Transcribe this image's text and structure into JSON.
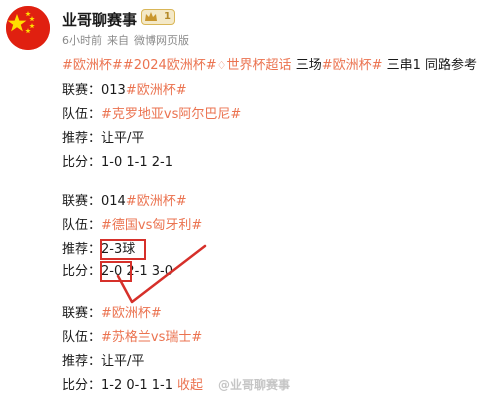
{
  "post": {
    "username": "业哥聊赛事",
    "level": "1",
    "time": "6小时前",
    "source_prefix": "来自",
    "source": "微博网页版"
  },
  "content": {
    "header": {
      "tag1": "#欧洲杯#",
      "tag2": "#2024欧洲杯#",
      "diamond": "♢",
      "topic": "世界杯超话",
      "text1": " 三场",
      "tag3": "#欧洲杯#",
      "text2": " 三串1 同路参考"
    },
    "matches": [
      {
        "league_label": "联赛：",
        "league_code": "013",
        "league_tag": "#欧洲杯#",
        "team_label": "队伍：",
        "team_tag": "#克罗地亚vs阿尔巴尼#",
        "pick_label": "推荐：",
        "pick": "让平/平",
        "score_label": "比分：",
        "scores": "1-0 1-1 2-1"
      },
      {
        "league_label": "联赛：",
        "league_code": "014",
        "league_tag": "#欧洲杯#",
        "team_label": "队伍：",
        "team_tag": "#德国vs匈牙利#",
        "pick_label": "推荐：",
        "pick": "2-3球",
        "score_label": "比分：",
        "score_hit": "2-0",
        "scores_rest": " 2-1 3-0"
      },
      {
        "league_label": "联赛：",
        "league_tag": "#欧洲杯#",
        "team_label": "队伍：",
        "team_tag": "#苏格兰vs瑞士#",
        "pick_label": "推荐：",
        "pick": "让平/平",
        "score_label": "比分：",
        "scores": "1-2 0-1 1-1",
        "expand": "收起"
      }
    ]
  },
  "watermark": "@业哥聊赛事",
  "colors": {
    "tag": "#eb7350",
    "highlight_box": "#d6302a",
    "avatar_bg": "#e02010",
    "star": "#ffde00"
  }
}
